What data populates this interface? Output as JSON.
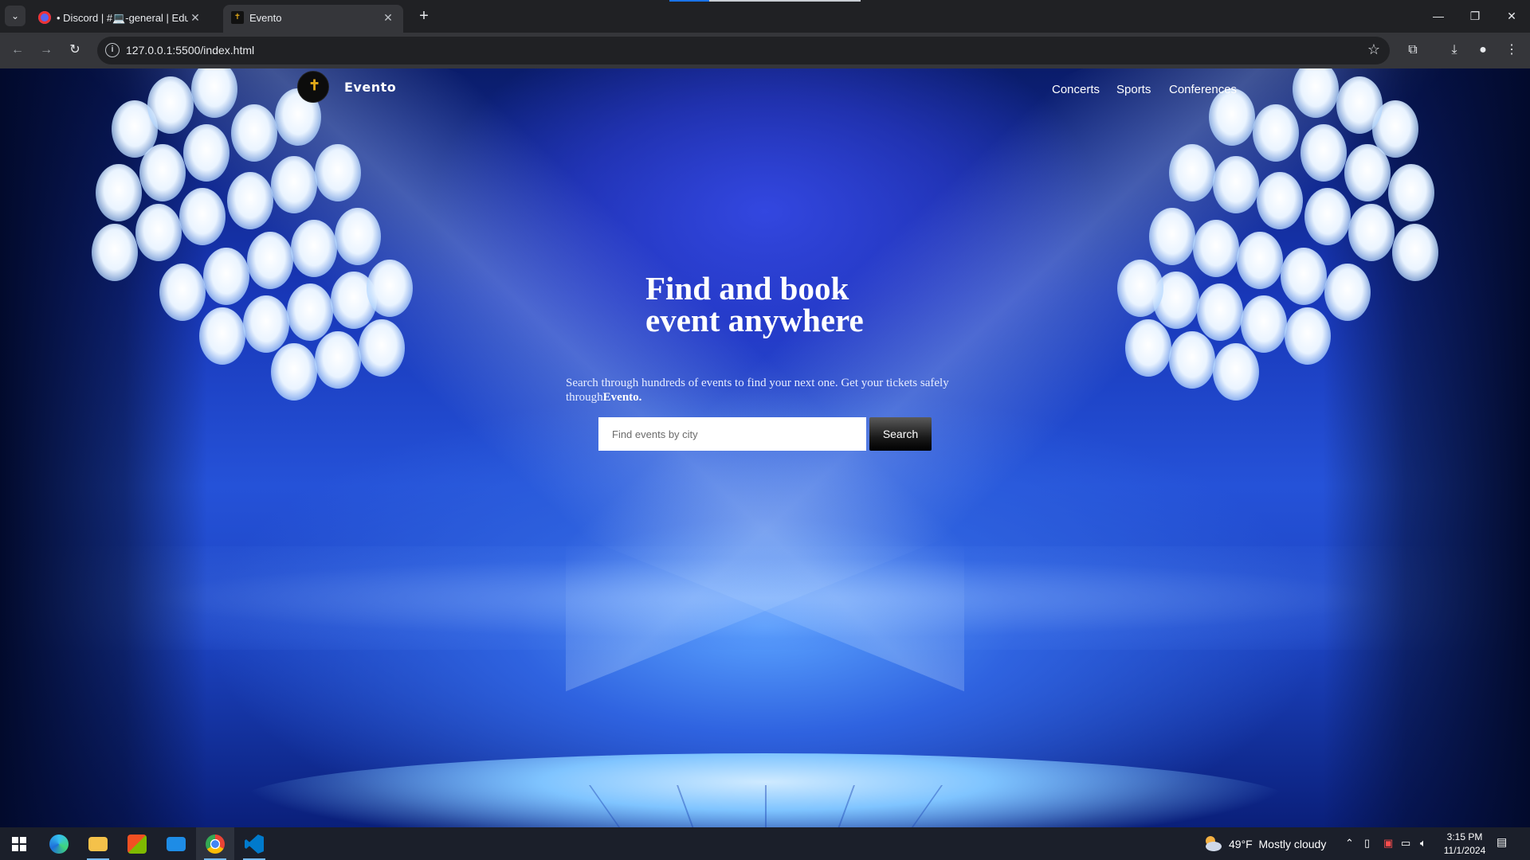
{
  "browser": {
    "tabs": [
      {
        "title": "• Discord | #💻-general | Edute",
        "active": false
      },
      {
        "title": "Evento",
        "active": true
      }
    ],
    "url": "127.0.0.1:5500/index.html"
  },
  "site": {
    "brand": "Evento",
    "nav": [
      "Concerts",
      "Sports",
      "Conferences"
    ],
    "hero": {
      "title_line1": "Find and book",
      "title_line2": "event anywhere",
      "subtitle": "Search through hundreds of events to find your next one. Get your tickets safely through",
      "subtitle_brand": "Evento."
    },
    "search": {
      "placeholder": "Find events by city",
      "button_label": "Search"
    }
  },
  "taskbar": {
    "weather_temp": "49°F",
    "weather_text": "Mostly cloudy",
    "time": "3:15 PM",
    "date": "11/1/2024"
  },
  "colors": {
    "page_blue": "#1f4bd0",
    "light_white": "#eaf4ff",
    "logo_gold": "#e0a818",
    "chrome_dark": "#202124",
    "chrome_toolbar": "#35363a",
    "taskbar_bg": "#1b1f2a"
  }
}
